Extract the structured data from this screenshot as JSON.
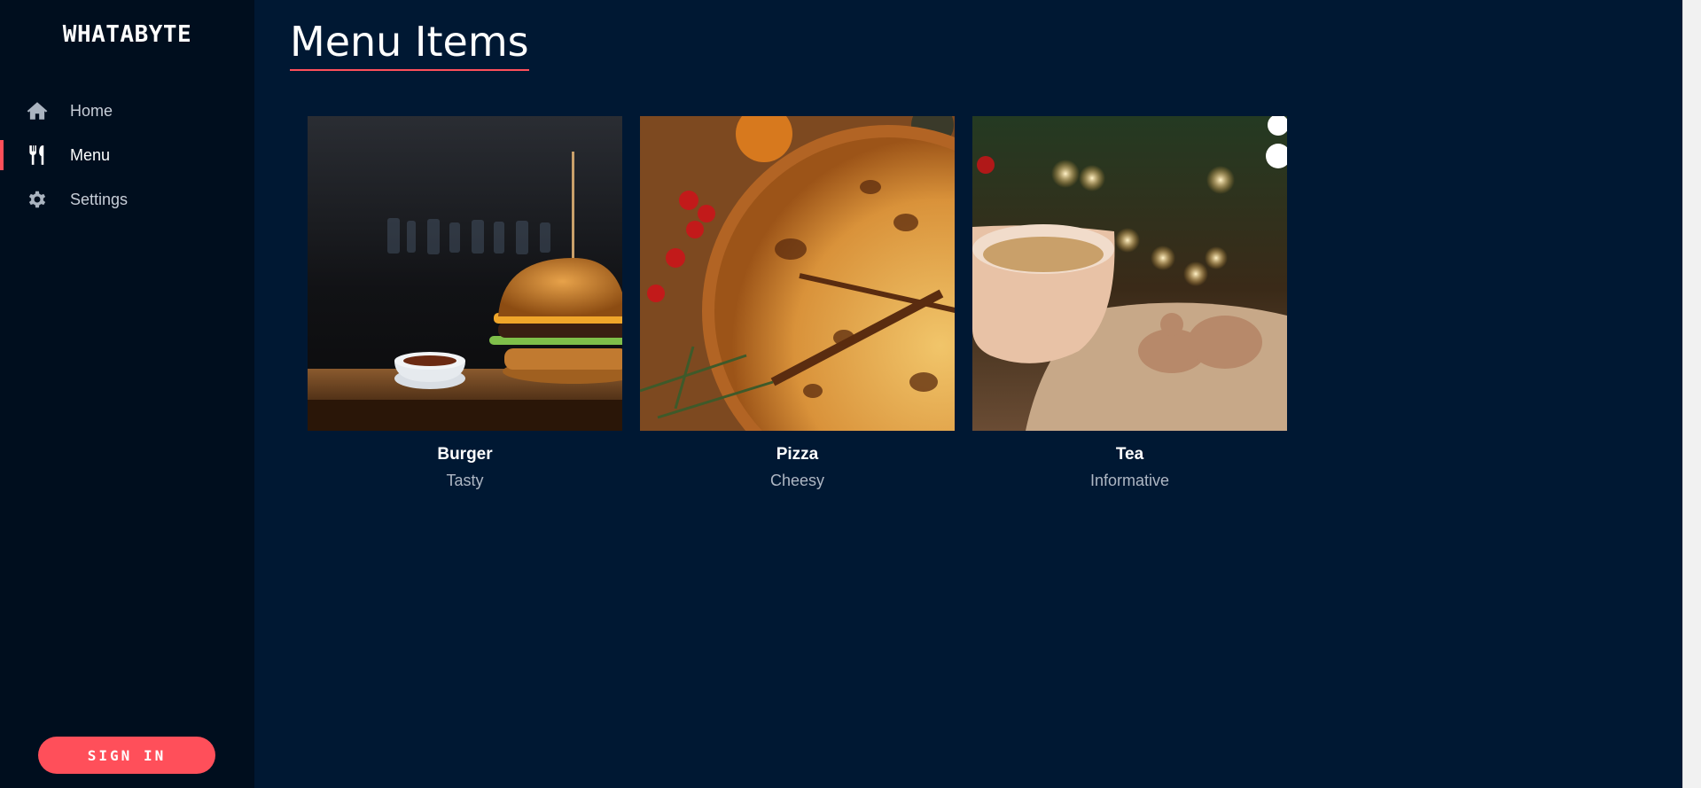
{
  "brand": {
    "name": "WHATABYTE"
  },
  "sidebar": {
    "items": [
      {
        "label": "Home",
        "icon": "home-icon"
      },
      {
        "label": "Menu",
        "icon": "utensils-icon",
        "active": true
      },
      {
        "label": "Settings",
        "icon": "gear-icon"
      }
    ],
    "signin_label": "SIGN IN"
  },
  "main": {
    "title": "Menu Items",
    "items": [
      {
        "name": "Burger",
        "description": "Tasty",
        "image": "burger-photo"
      },
      {
        "name": "Pizza",
        "description": "Cheesy",
        "image": "pizza-photo"
      },
      {
        "name": "Tea",
        "description": "Informative",
        "image": "tea-photo"
      }
    ]
  },
  "colors": {
    "background": "#001833",
    "sidebar": "#000e1e",
    "accent": "#ff4f5a"
  }
}
